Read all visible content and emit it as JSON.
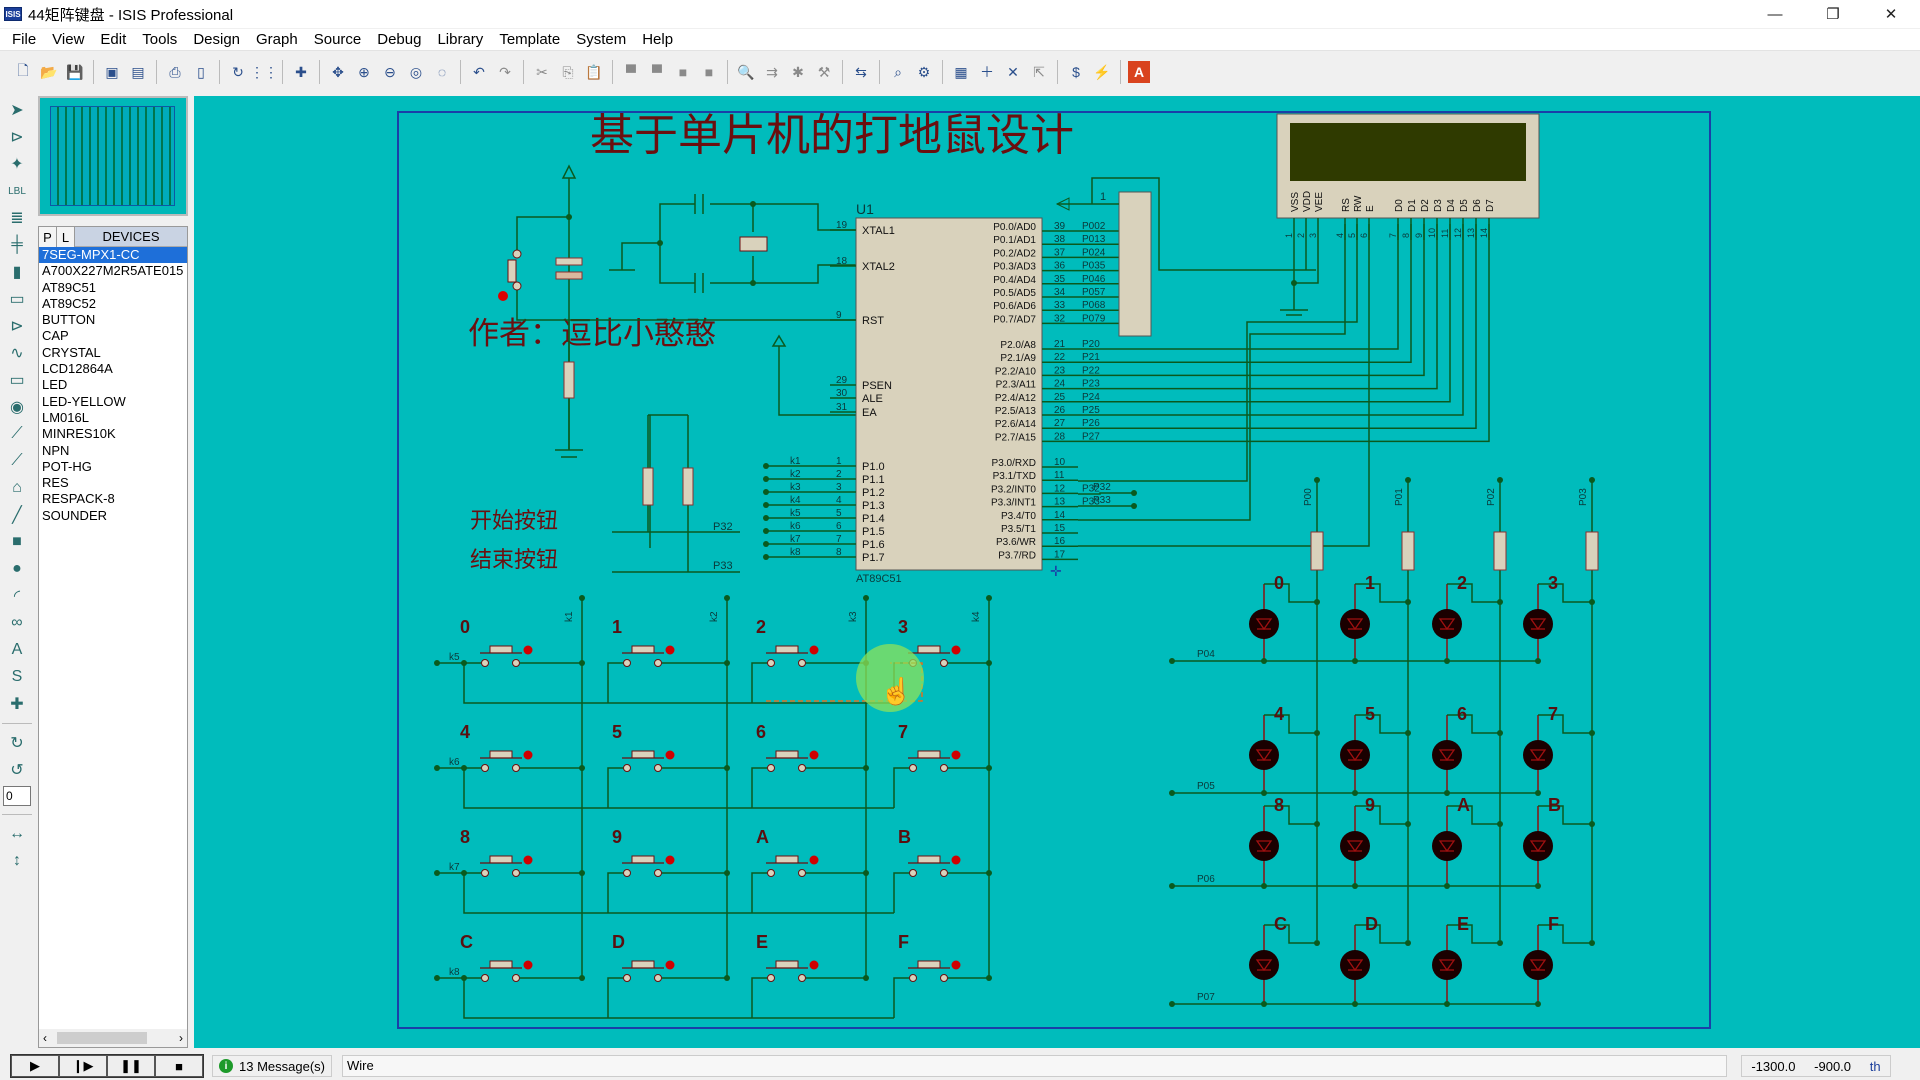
{
  "window": {
    "app_icon_text": "ISIS",
    "title": "44矩阵键盘 - ISIS Professional",
    "minimize": "—",
    "maximize": "❐",
    "close": "✕"
  },
  "menu": [
    "File",
    "View",
    "Edit",
    "Tools",
    "Design",
    "Graph",
    "Source",
    "Debug",
    "Library",
    "Template",
    "System",
    "Help"
  ],
  "toolbar": {
    "groups": [
      [
        {
          "icon": "new-file-icon",
          "glyph": "🗋"
        },
        {
          "icon": "open-folder-icon",
          "glyph": "📂"
        },
        {
          "icon": "save-icon",
          "glyph": "💾"
        }
      ],
      [
        {
          "icon": "import-section-icon",
          "glyph": "▣"
        },
        {
          "icon": "export-section-icon",
          "glyph": "▤"
        }
      ],
      [
        {
          "icon": "print-icon",
          "glyph": "⎙"
        },
        {
          "icon": "print-area-icon",
          "glyph": "▯"
        }
      ],
      [
        {
          "icon": "refresh-icon",
          "glyph": "↻"
        },
        {
          "icon": "grid-icon",
          "glyph": "⋮⋮"
        }
      ],
      [
        {
          "icon": "origin-icon",
          "glyph": "✚"
        }
      ],
      [
        {
          "icon": "pan-icon",
          "glyph": "✥"
        },
        {
          "icon": "zoom-in-icon",
          "glyph": "⊕"
        },
        {
          "icon": "zoom-out-icon",
          "glyph": "⊖"
        },
        {
          "icon": "zoom-all-icon",
          "glyph": "◎"
        },
        {
          "icon": "zoom-area-icon",
          "glyph": "◌"
        }
      ],
      [
        {
          "icon": "undo-icon",
          "glyph": "↶"
        },
        {
          "icon": "redo-icon",
          "glyph": "↷",
          "grey": true
        }
      ],
      [
        {
          "icon": "cut-icon",
          "glyph": "✂",
          "grey": true
        },
        {
          "icon": "copy-icon",
          "glyph": "⎘",
          "grey": true
        },
        {
          "icon": "paste-icon",
          "glyph": "📋",
          "grey": true
        }
      ],
      [
        {
          "icon": "block-copy-icon",
          "glyph": "▀",
          "grey": true
        },
        {
          "icon": "block-move-icon",
          "glyph": "▀",
          "grey": true
        },
        {
          "icon": "block-rotate-icon",
          "glyph": "■",
          "grey": true
        },
        {
          "icon": "block-delete-icon",
          "glyph": "■",
          "grey": true
        }
      ],
      [
        {
          "icon": "pick-device-icon",
          "glyph": "🔍"
        },
        {
          "icon": "make-device-icon",
          "glyph": "⇉",
          "grey": true
        },
        {
          "icon": "packaging-tool-icon",
          "glyph": "✱",
          "grey": true
        },
        {
          "icon": "decompose-icon",
          "glyph": "⚒",
          "grey": true
        }
      ],
      [
        {
          "icon": "wire-autorouter-icon",
          "glyph": "⇆"
        }
      ],
      [
        {
          "icon": "search-tag-icon",
          "glyph": "⌕"
        },
        {
          "icon": "property-assignment-icon",
          "glyph": "⚙"
        }
      ],
      [
        {
          "icon": "new-sheet-icon",
          "glyph": "▦"
        },
        {
          "icon": "add-sheet-icon",
          "glyph": "＋"
        },
        {
          "icon": "remove-sheet-icon",
          "glyph": "✕"
        },
        {
          "icon": "exit-parent-icon",
          "glyph": "⇱",
          "grey": true
        }
      ],
      [
        {
          "icon": "bill-of-materials-icon",
          "glyph": "$"
        },
        {
          "icon": "electrical-rule-check-icon",
          "glyph": "⚡"
        }
      ],
      [
        {
          "icon": "ares-icon",
          "glyph": "A"
        }
      ]
    ]
  },
  "left_tools": {
    "top": [
      {
        "icon": "selection-mode-icon",
        "glyph": "➤"
      },
      {
        "icon": "component-mode-icon",
        "glyph": "⊳"
      },
      {
        "icon": "junction-dot-icon",
        "glyph": "✦"
      },
      {
        "icon": "wire-label-icon",
        "glyph": "LBL"
      },
      {
        "icon": "text-script-icon",
        "glyph": "≣"
      },
      {
        "icon": "buses-icon",
        "glyph": "╪"
      },
      {
        "icon": "subcircuit-icon",
        "glyph": "▮"
      },
      {
        "icon": "terminals-icon",
        "glyph": "▭"
      },
      {
        "icon": "device-pins-icon",
        "glyph": "⊳"
      },
      {
        "icon": "graph-mode-icon",
        "glyph": "∿"
      },
      {
        "icon": "tape-recorder-icon",
        "glyph": "▭"
      },
      {
        "icon": "generator-icon",
        "glyph": "◉"
      },
      {
        "icon": "voltage-probe-icon",
        "glyph": "⟋"
      },
      {
        "icon": "current-probe-icon",
        "glyph": "⟋"
      },
      {
        "icon": "virtual-instruments-icon",
        "glyph": "⌂"
      }
    ],
    "shapes": [
      {
        "icon": "line-icon",
        "glyph": "╱"
      },
      {
        "icon": "box-icon",
        "glyph": "■"
      },
      {
        "icon": "circle-icon",
        "glyph": "●"
      },
      {
        "icon": "arc-icon",
        "glyph": "◜"
      },
      {
        "icon": "path-icon",
        "glyph": "∞"
      },
      {
        "icon": "text-icon",
        "glyph": "A"
      },
      {
        "icon": "symbol-icon",
        "glyph": "S"
      },
      {
        "icon": "marker-icon",
        "glyph": "✚"
      }
    ],
    "rotate": [
      {
        "icon": "rotate-clockwise-icon",
        "glyph": "↻"
      },
      {
        "icon": "rotate-anticlockwise-icon",
        "glyph": "↺"
      }
    ],
    "rotation_value": "0",
    "mirror": [
      {
        "icon": "mirror-horizontal-icon",
        "glyph": "↔"
      },
      {
        "icon": "mirror-vertical-icon",
        "glyph": "↕"
      }
    ]
  },
  "devices": {
    "tab_p": "P",
    "tab_l": "L",
    "title": "DEVICES",
    "items": [
      "7SEG-MPX1-CC",
      "A700X227M2R5ATE015",
      "AT89C51",
      "AT89C52",
      "BUTTON",
      "CAP",
      "CRYSTAL",
      "LCD12864A",
      "LED",
      "LED-YELLOW",
      "LM016L",
      "MINRES10K",
      "NPN",
      "POT-HG",
      "RES",
      "RESPACK-8",
      "SOUNDER"
    ],
    "selected": "7SEG-MPX1-CC",
    "scroll_left": "‹",
    "scroll_right": "›"
  },
  "schematic": {
    "title": "基于单片机的打地鼠设计",
    "author": "作者：逗比小憨憨",
    "start_button": "开始按钮",
    "stop_button": "结束按钮",
    "mcu": {
      "ref": "U1",
      "part": "AT89C51",
      "left_pins": [
        {
          "num": "19",
          "name": "XTAL1"
        },
        {
          "num": "18",
          "name": "XTAL2"
        },
        {
          "num": "9",
          "name": "RST"
        },
        {
          "num": "29",
          "name": "PSEN"
        },
        {
          "num": "30",
          "name": "ALE"
        },
        {
          "num": "31",
          "name": "EA"
        },
        {
          "num": "1",
          "name": "P1.0",
          "net": "k1"
        },
        {
          "num": "2",
          "name": "P1.1",
          "net": "k2"
        },
        {
          "num": "3",
          "name": "P1.2",
          "net": "k3"
        },
        {
          "num": "4",
          "name": "P1.3",
          "net": "k4"
        },
        {
          "num": "5",
          "name": "P1.4",
          "net": "k5"
        },
        {
          "num": "6",
          "name": "P1.5",
          "net": "k6"
        },
        {
          "num": "7",
          "name": "P1.6",
          "net": "k7"
        },
        {
          "num": "8",
          "name": "P1.7",
          "net": "k8"
        }
      ],
      "right_p0": [
        {
          "num": "39",
          "name": "P0.0/AD0",
          "net": "P002"
        },
        {
          "num": "38",
          "name": "P0.1/AD1",
          "net": "P013"
        },
        {
          "num": "37",
          "name": "P0.2/AD2",
          "net": "P024"
        },
        {
          "num": "36",
          "name": "P0.3/AD3",
          "net": "P035"
        },
        {
          "num": "35",
          "name": "P0.4/AD4",
          "net": "P046"
        },
        {
          "num": "34",
          "name": "P0.5/AD5",
          "net": "P057"
        },
        {
          "num": "33",
          "name": "P0.6/AD6",
          "net": "P068"
        },
        {
          "num": "32",
          "name": "P0.7/AD7",
          "net": "P079"
        }
      ],
      "right_p2": [
        {
          "num": "21",
          "name": "P2.0/A8",
          "net": "P20"
        },
        {
          "num": "22",
          "name": "P2.1/A9",
          "net": "P21"
        },
        {
          "num": "23",
          "name": "P2.2/A10",
          "net": "P22"
        },
        {
          "num": "24",
          "name": "P2.3/A11",
          "net": "P23"
        },
        {
          "num": "25",
          "name": "P2.4/A12",
          "net": "P24"
        },
        {
          "num": "26",
          "name": "P2.5/A13",
          "net": "P25"
        },
        {
          "num": "27",
          "name": "P2.6/A14",
          "net": "P26"
        },
        {
          "num": "28",
          "name": "P2.7/A15",
          "net": "P27"
        }
      ],
      "right_p3": [
        {
          "num": "10",
          "name": "P3.0/RXD"
        },
        {
          "num": "11",
          "name": "P3.1/TXD"
        },
        {
          "num": "12",
          "name": "P3.2/INT0",
          "net": "P32"
        },
        {
          "num": "13",
          "name": "P3.3/INT1",
          "net": "P33"
        },
        {
          "num": "14",
          "name": "P3.4/T0"
        },
        {
          "num": "15",
          "name": "P3.5/T1"
        },
        {
          "num": "16",
          "name": "P3.6/WR"
        },
        {
          "num": "17",
          "name": "P3.7/RD"
        }
      ]
    },
    "respack_pin": "1",
    "lcd": {
      "pins": [
        "VSS",
        "VDD",
        "VEE",
        "RS",
        "RW",
        "E",
        "D0",
        "D1",
        "D2",
        "D3",
        "D4",
        "D5",
        "D6",
        "D7"
      ],
      "pin_numbers": [
        "1",
        "2",
        "3",
        "4",
        "5",
        "6",
        "7",
        "8",
        "9",
        "10",
        "11",
        "12",
        "13",
        "14"
      ]
    },
    "keypad": {
      "keys": [
        "0",
        "1",
        "2",
        "3",
        "4",
        "5",
        "6",
        "7",
        "8",
        "9",
        "A",
        "B",
        "C",
        "D",
        "E",
        "F"
      ],
      "row_nets": [
        "k5",
        "k6",
        "k7",
        "k8"
      ],
      "col_nets": [
        "k1",
        "k2",
        "k3",
        "k4"
      ]
    },
    "led_matrix": {
      "labels": [
        "0",
        "1",
        "2",
        "3",
        "4",
        "5",
        "6",
        "7",
        "8",
        "9",
        "A",
        "B",
        "C",
        "D",
        "E",
        "F"
      ],
      "col_nets": [
        "P00",
        "P01",
        "P02",
        "P03"
      ],
      "row_nets": [
        "P04",
        "P05",
        "P06",
        "P07"
      ]
    }
  },
  "status": {
    "play": "▶",
    "step": "❙▶",
    "pause": "❚❚",
    "stop": "■",
    "messages": "13 Message(s)",
    "mode": "Wire",
    "x": "-1300.0",
    "y": "-900.0",
    "unit": "th"
  },
  "colors": {
    "canvas": "#00bcbc",
    "wire": "#0a5a1e",
    "text_dark_red": "#6b0f0f",
    "component_fill": "#d9d2bc",
    "lcd_screen": "#2f3a00",
    "selection": "#1e6fd9"
  }
}
